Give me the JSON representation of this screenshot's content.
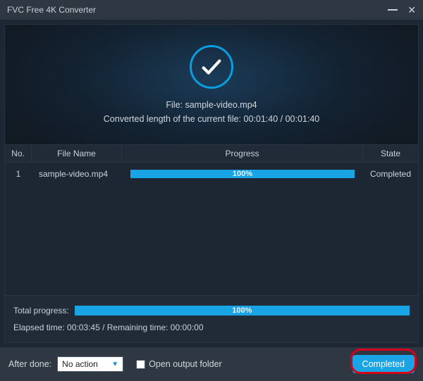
{
  "window": {
    "title": "FVC Free 4K Converter"
  },
  "hero": {
    "fileLine": "File: sample-video.mp4",
    "convertedLine": "Converted length of the current file: 00:01:40 / 00:01:40"
  },
  "columns": {
    "no": "No.",
    "name": "File Name",
    "progress": "Progress",
    "state": "State"
  },
  "rows": [
    {
      "no": "1",
      "name": "sample-video.mp4",
      "progress": "100%",
      "state": "Completed"
    }
  ],
  "total": {
    "label": "Total progress:",
    "value": "100%"
  },
  "timing": "Elapsed time: 00:03:45 / Remaining time: 00:00:00",
  "footer": {
    "afterDoneLabel": "After done:",
    "afterDoneValue": "No action",
    "openFolderLabel": "Open output folder",
    "buttonLabel": "Completed"
  }
}
